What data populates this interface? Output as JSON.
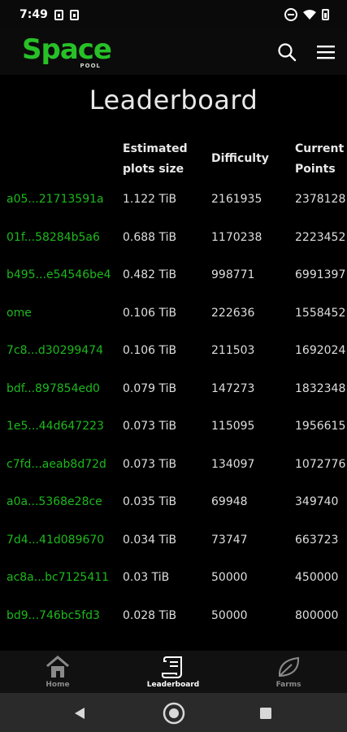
{
  "status_bar": {
    "time": "7:49"
  },
  "app_bar": {
    "logo_text": "Space",
    "logo_sub": "POOL"
  },
  "page": {
    "title": "Leaderboard"
  },
  "table": {
    "headers": {
      "estimated_line1": "Estimated",
      "estimated_line2": "plots size",
      "difficulty": "Difficulty",
      "points_line1": "Current",
      "points_line2": "Points"
    },
    "rows": [
      {
        "farmer": "a05...21713591a",
        "size": "1.122 TiB",
        "difficulty": "2161935",
        "points": "2378128"
      },
      {
        "farmer": "01f...58284b5a6",
        "size": "0.688 TiB",
        "difficulty": "1170238",
        "points": "2223452"
      },
      {
        "farmer": "b495...e54546be4",
        "size": "0.482 TiB",
        "difficulty": "998771",
        "points": "6991397"
      },
      {
        "farmer": "ome",
        "size": "0.106 TiB",
        "difficulty": "222636",
        "points": "1558452"
      },
      {
        "farmer": "7c8...d30299474",
        "size": "0.106 TiB",
        "difficulty": "211503",
        "points": "1692024"
      },
      {
        "farmer": "bdf...897854ed0",
        "size": "0.079 TiB",
        "difficulty": "147273",
        "points": "1832348"
      },
      {
        "farmer": "1e5...44d647223",
        "size": "0.073 TiB",
        "difficulty": "115095",
        "points": "1956615"
      },
      {
        "farmer": "c7fd...aeab8d72d",
        "size": "0.073 TiB",
        "difficulty": "134097",
        "points": "1072776"
      },
      {
        "farmer": "a0a...5368e28ce",
        "size": "0.035 TiB",
        "difficulty": "69948",
        "points": "349740"
      },
      {
        "farmer": "7d4...41d089670",
        "size": "0.034 TiB",
        "difficulty": "73747",
        "points": "663723"
      },
      {
        "farmer": "ac8a...bc7125411",
        "size": "0.03 TiB",
        "difficulty": "50000",
        "points": "450000"
      },
      {
        "farmer": "bd9...746bc5fd3",
        "size": "0.028 TiB",
        "difficulty": "50000",
        "points": "800000"
      }
    ]
  },
  "bottom_nav": {
    "items": [
      {
        "label": "Home",
        "icon": "home-icon"
      },
      {
        "label": "Leaderboard",
        "icon": "leaderboard-icon"
      },
      {
        "label": "Farms",
        "icon": "leaf-icon"
      }
    ],
    "active": "Leaderboard"
  },
  "colors": {
    "accent": "#1db81d",
    "background": "#000000"
  }
}
